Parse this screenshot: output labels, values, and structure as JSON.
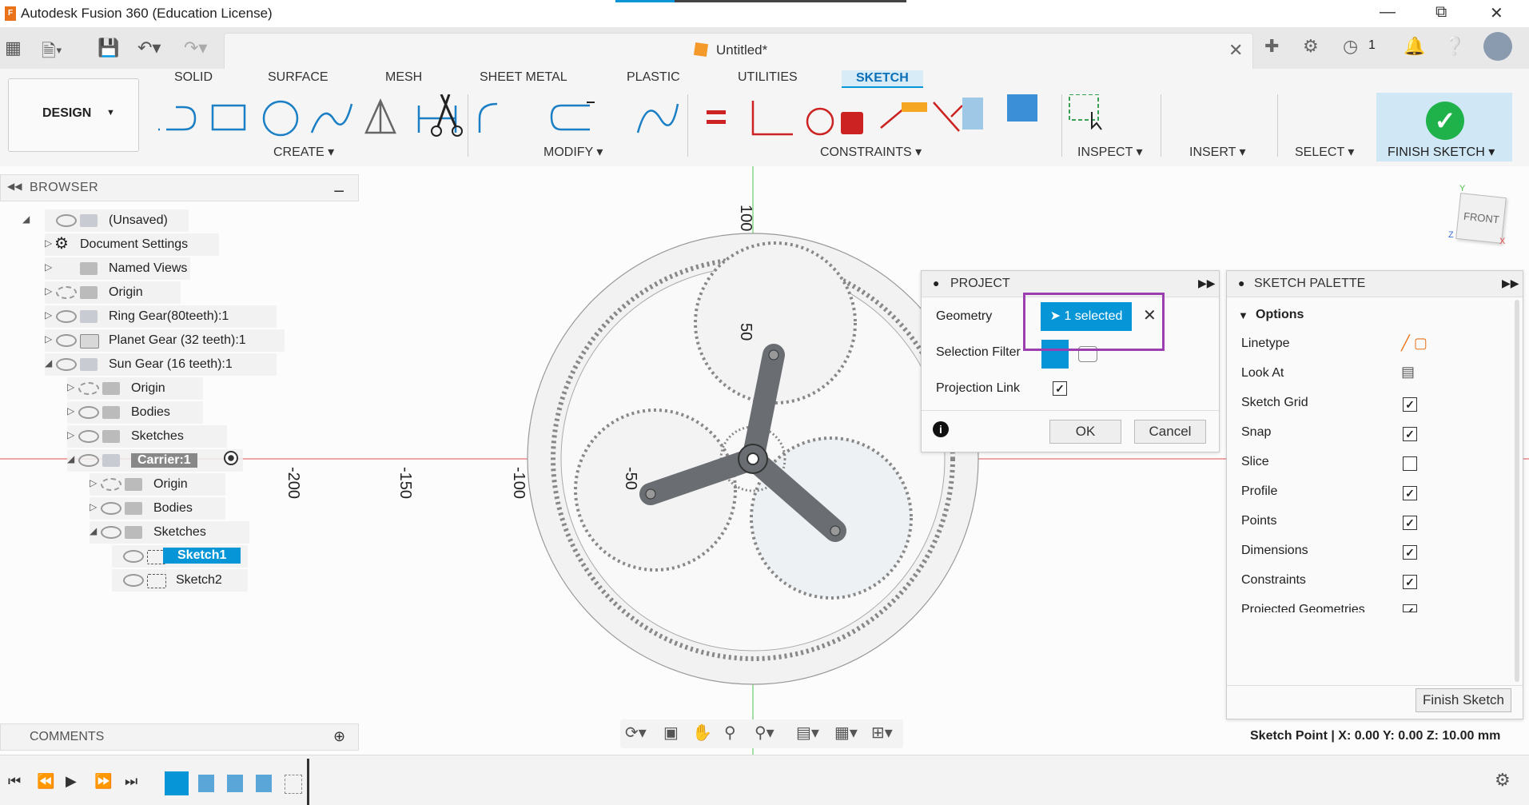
{
  "app": {
    "title": "Autodesk Fusion 360 (Education License)",
    "logo_letter": "F",
    "document_name": "Untitled*",
    "notification_count": "1"
  },
  "ribbon": {
    "tabs": [
      "SOLID",
      "SURFACE",
      "MESH",
      "SHEET METAL",
      "PLASTIC",
      "UTILITIES",
      "SKETCH"
    ],
    "active_tab": "SKETCH",
    "workspace": "DESIGN",
    "groups": {
      "create": "CREATE",
      "modify": "MODIFY",
      "constraints": "CONSTRAINTS",
      "inspect": "INSPECT",
      "insert": "INSERT",
      "select": "SELECT",
      "finish": "FINISH SKETCH"
    }
  },
  "browser": {
    "title": "BROWSER",
    "items": [
      {
        "label": "(Unsaved)"
      },
      {
        "label": "Document Settings"
      },
      {
        "label": "Named Views"
      },
      {
        "label": "Origin"
      },
      {
        "label": "Ring Gear(80teeth):1"
      },
      {
        "label": "Planet Gear (32 teeth):1"
      },
      {
        "label": "Sun Gear (16 teeth):1"
      },
      {
        "label": "Origin"
      },
      {
        "label": "Bodies"
      },
      {
        "label": "Sketches"
      },
      {
        "label": "Carrier:1"
      },
      {
        "label": "Origin"
      },
      {
        "label": "Bodies"
      },
      {
        "label": "Sketches"
      },
      {
        "label": "Sketch1"
      },
      {
        "label": "Sketch2"
      }
    ]
  },
  "comments": {
    "title": "COMMENTS"
  },
  "viewcube": {
    "face": "FRONT",
    "x": "X",
    "y": "Y",
    "z": "Z"
  },
  "canvas": {
    "axis_labels": [
      "100",
      "50",
      "-50",
      "-100",
      "-150",
      "-200"
    ]
  },
  "project": {
    "title": "PROJECT",
    "geometry_label": "Geometry",
    "geometry_value": "1 selected",
    "selection_filter_label": "Selection Filter",
    "projection_link_label": "Projection Link",
    "projection_link_checked": true,
    "ok": "OK",
    "cancel": "Cancel"
  },
  "palette": {
    "title": "SKETCH PALETTE",
    "section": "Options",
    "rows": [
      {
        "label": "Linetype"
      },
      {
        "label": "Look At"
      },
      {
        "label": "Sketch Grid",
        "checked": true
      },
      {
        "label": "Snap",
        "checked": true
      },
      {
        "label": "Slice",
        "checked": false
      },
      {
        "label": "Profile",
        "checked": true
      },
      {
        "label": "Points",
        "checked": true
      },
      {
        "label": "Dimensions",
        "checked": true
      },
      {
        "label": "Constraints",
        "checked": true
      },
      {
        "label": "Projected Geometries",
        "checked": true
      }
    ],
    "finish_button": "Finish Sketch"
  },
  "status": {
    "text": "Sketch Point | X: 0.00 Y: 0.00 Z: 10.00 mm"
  },
  "colors": {
    "accent": "#0696d7",
    "highlight": "#9b3fb0",
    "finish_green": "#1fb24a"
  }
}
